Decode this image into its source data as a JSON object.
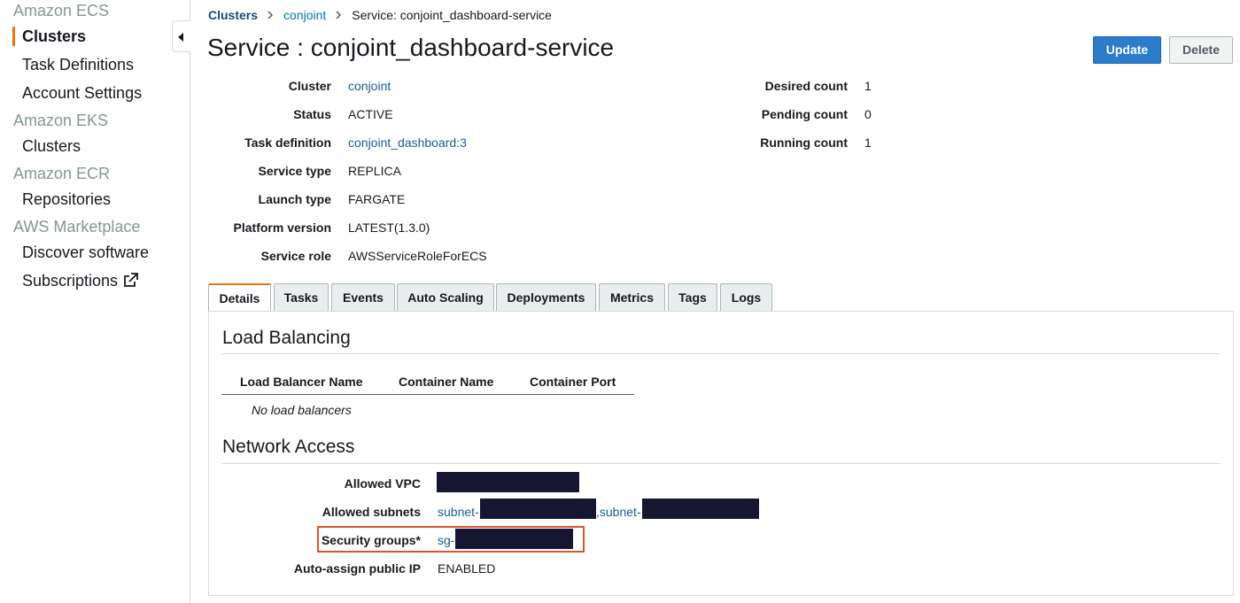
{
  "sidebar": {
    "groups": [
      {
        "title": "Amazon ECS",
        "items": [
          "Clusters",
          "Task Definitions",
          "Account Settings"
        ]
      },
      {
        "title": "Amazon EKS",
        "items": [
          "Clusters"
        ]
      },
      {
        "title": "Amazon ECR",
        "items": [
          "Repositories"
        ]
      },
      {
        "title": "AWS Marketplace",
        "items": [
          "Discover software",
          "Subscriptions"
        ]
      }
    ],
    "active_item": "Clusters",
    "external_icon": "external-link-icon",
    "collapse_icon": "caret-left-icon"
  },
  "breadcrumb": {
    "items": [
      "Clusters",
      "conjoint",
      "Service: conjoint_dashboard-service"
    ],
    "separator_icon": "chevron-right-icon"
  },
  "page": {
    "title": "Service : conjoint_dashboard-service",
    "update_label": "Update",
    "delete_label": "Delete"
  },
  "details_left": [
    {
      "label": "Cluster",
      "value": "conjoint",
      "link": true
    },
    {
      "label": "Status",
      "value": "ACTIVE",
      "link": false
    },
    {
      "label": "Task definition",
      "value": "conjoint_dashboard:3",
      "link": true
    },
    {
      "label": "Service type",
      "value": "REPLICA",
      "link": false
    },
    {
      "label": "Launch type",
      "value": "FARGATE",
      "link": false
    },
    {
      "label": "Platform version",
      "value": "LATEST(1.3.0)",
      "link": false
    },
    {
      "label": "Service role",
      "value": "AWSServiceRoleForECS",
      "link": false
    }
  ],
  "details_right": [
    {
      "label": "Desired count",
      "value": "1"
    },
    {
      "label": "Pending count",
      "value": "0"
    },
    {
      "label": "Running count",
      "value": "1"
    }
  ],
  "tabs": [
    "Details",
    "Tasks",
    "Events",
    "Auto Scaling",
    "Deployments",
    "Metrics",
    "Tags",
    "Logs"
  ],
  "active_tab": "Details",
  "load_balancing": {
    "title": "Load Balancing",
    "columns": [
      "Load Balancer Name",
      "Container Name",
      "Container Port"
    ],
    "empty_message": "No load balancers"
  },
  "network_access": {
    "title": "Network Access",
    "allowed_vpc_label": "Allowed VPC",
    "allowed_subnets_label": "Allowed subnets",
    "subnet_prefix_1": "subnet-",
    "subnet_prefix_2": ",subnet-",
    "security_groups_label": "Security groups*",
    "security_group_prefix": "sg-",
    "auto_assign_label": "Auto-assign public IP",
    "auto_assign_value": "ENABLED"
  },
  "colors": {
    "accent_orange": "#ec7211",
    "link_blue": "#0073bb",
    "primary_button": "#2d7ccc",
    "highlight_box": "#d9532c",
    "redaction": "#161633"
  }
}
